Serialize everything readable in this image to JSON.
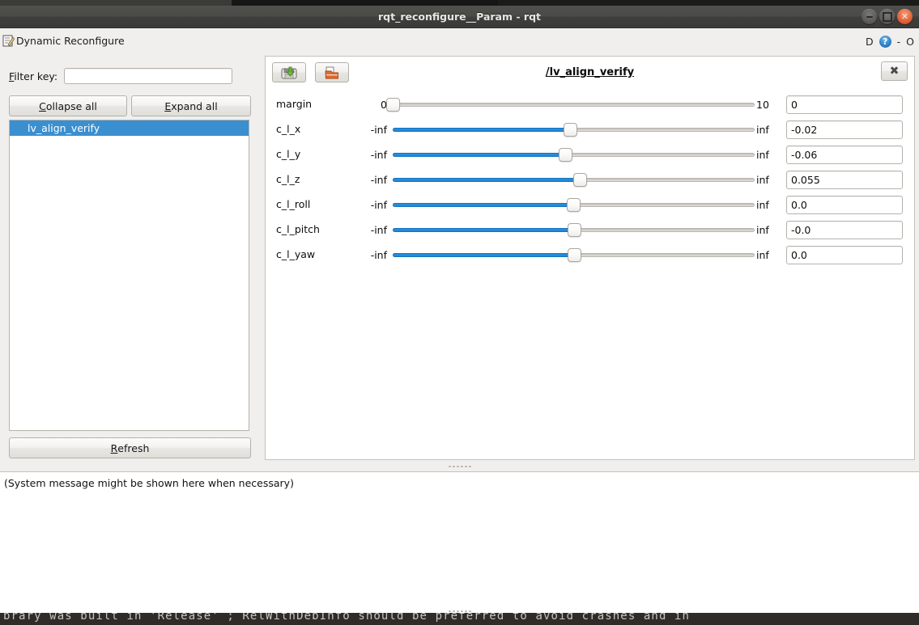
{
  "window": {
    "title": "rqt_reconfigure__Param - rqt",
    "buttons": {
      "minimize": "minimize-button",
      "maximize": "maximize-button",
      "close": "✕"
    }
  },
  "widget_header": {
    "title": "Dynamic Reconfigure",
    "dock_label": "D",
    "help_label": "?",
    "minimize_label": "-",
    "close_label": "O"
  },
  "sidebar": {
    "filter_label_prefix": "F",
    "filter_label_rest": "ilter key:",
    "filter_value": "",
    "filter_placeholder": "",
    "collapse_all_prefix": "C",
    "collapse_all_rest": "ollapse all",
    "expand_all_prefix": "E",
    "expand_all_rest": "xpand all",
    "tree_items": [
      {
        "label": "lv_align_verify",
        "selected": true
      }
    ],
    "refresh_prefix": "R",
    "refresh_rest": "efresh"
  },
  "main": {
    "node_title": "/lv_align_verify",
    "save_button_title": "save-parameters",
    "load_button_title": "load-parameters",
    "close_label": "✖",
    "params": [
      {
        "name": "margin",
        "min": "0",
        "max": "10",
        "value": "0",
        "fill_pct": 0.0,
        "handle_pct": 0.013
      },
      {
        "name": "c_l_x",
        "min": "-inf",
        "max": "inf",
        "value": "-0.02",
        "fill_pct": 49.0,
        "handle_pct": 49.0
      },
      {
        "name": "c_l_y",
        "min": "-inf",
        "max": "inf",
        "value": "-0.06",
        "fill_pct": 47.7,
        "handle_pct": 47.7
      },
      {
        "name": "c_l_z",
        "min": "-inf",
        "max": "inf",
        "value": "0.055",
        "fill_pct": 51.7,
        "handle_pct": 51.7
      },
      {
        "name": "c_l_roll",
        "min": "-inf",
        "max": "inf",
        "value": "0.0",
        "fill_pct": 49.9,
        "handle_pct": 49.9
      },
      {
        "name": "c_l_pitch",
        "min": "-inf",
        "max": "inf",
        "value": "-0.0",
        "fill_pct": 50.1,
        "handle_pct": 50.1
      },
      {
        "name": "c_l_yaw",
        "min": "-inf",
        "max": "inf",
        "value": "0.0",
        "fill_pct": 50.1,
        "handle_pct": 50.1
      }
    ]
  },
  "status": {
    "message": "(System message might be shown here when necessary)"
  },
  "terminal": {
    "line": "brary was built in 'Release' ; RelWithDebInfo should be preferred to avoid crashes and in"
  },
  "colors": {
    "selection_blue": "#3a8fd0",
    "slider_blue": "#1f86d6",
    "window_chrome": "#f0efed",
    "titlebar": "#3f3f3c",
    "close_button_red": "#e2633b"
  }
}
